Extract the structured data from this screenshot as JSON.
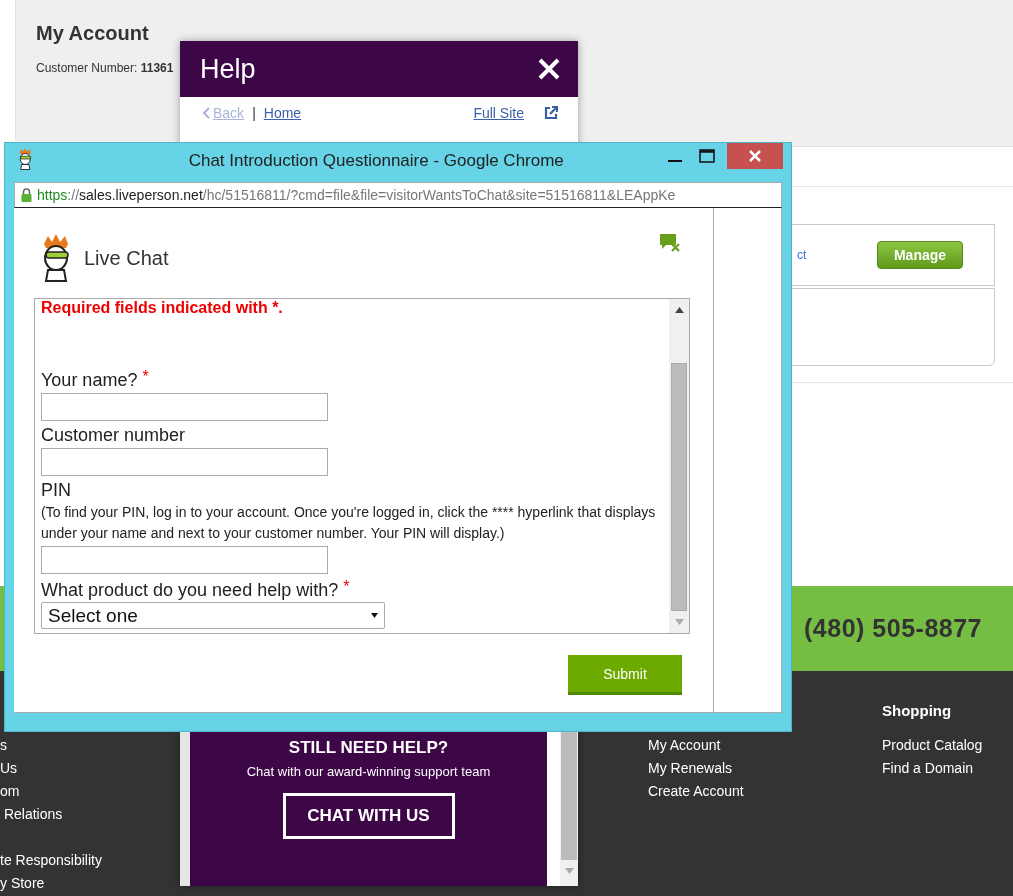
{
  "account": {
    "title": "My Account",
    "customer_label": "Customer Number:",
    "customer_number": "11361"
  },
  "card": {
    "link": "ct",
    "button": "Manage"
  },
  "phone_band": {
    "phone": "(480) 505-8877"
  },
  "footer": {
    "columns": [
      {
        "groups": [
          [
            "s",
            "Us",
            "om",
            " Relations"
          ],
          [
            "te Responsibility",
            "y Store"
          ]
        ]
      },
      {
        "groups": [
          [
            "My Account",
            "My Renewals",
            "Create Account"
          ]
        ]
      },
      {
        "heading": "Shopping",
        "groups": [
          [
            "Product Catalog",
            "Find a Domain"
          ]
        ]
      }
    ]
  },
  "help": {
    "title": "Help",
    "back": "Back",
    "separator": "|",
    "home": "Home",
    "full_site": "Full Site",
    "promo": {
      "heading": "STILL NEED HELP?",
      "text": "Chat with our award-winning support team",
      "button": "CHAT WITH US"
    }
  },
  "chrome": {
    "title": "Chat Introduction Questionnaire - Google Chrome",
    "url": {
      "scheme": "https",
      "separator": "://",
      "host": "sales.liveperson.net",
      "path": "/hc/51516811/?cmd=file&file=visitorWantsToChat&site=51516811&LEAppKe"
    },
    "chat": {
      "brand": "Live Chat",
      "required_note": "Required fields indicated with *.",
      "required_mark": "*",
      "fields": [
        {
          "kind": "text",
          "label": "Your name?",
          "required": true
        },
        {
          "kind": "text",
          "label": "Customer number",
          "required": false
        },
        {
          "kind": "text",
          "label": "PIN",
          "required": false,
          "note": "(To find your PIN, log in to your account. Once you're logged in, click the **** hyperlink that displays under your name and next to your customer number. Your PIN will display.)"
        },
        {
          "kind": "select",
          "label": "What product do you need help with?",
          "required": true,
          "value": "Select one"
        }
      ],
      "submit": "Submit"
    }
  }
}
